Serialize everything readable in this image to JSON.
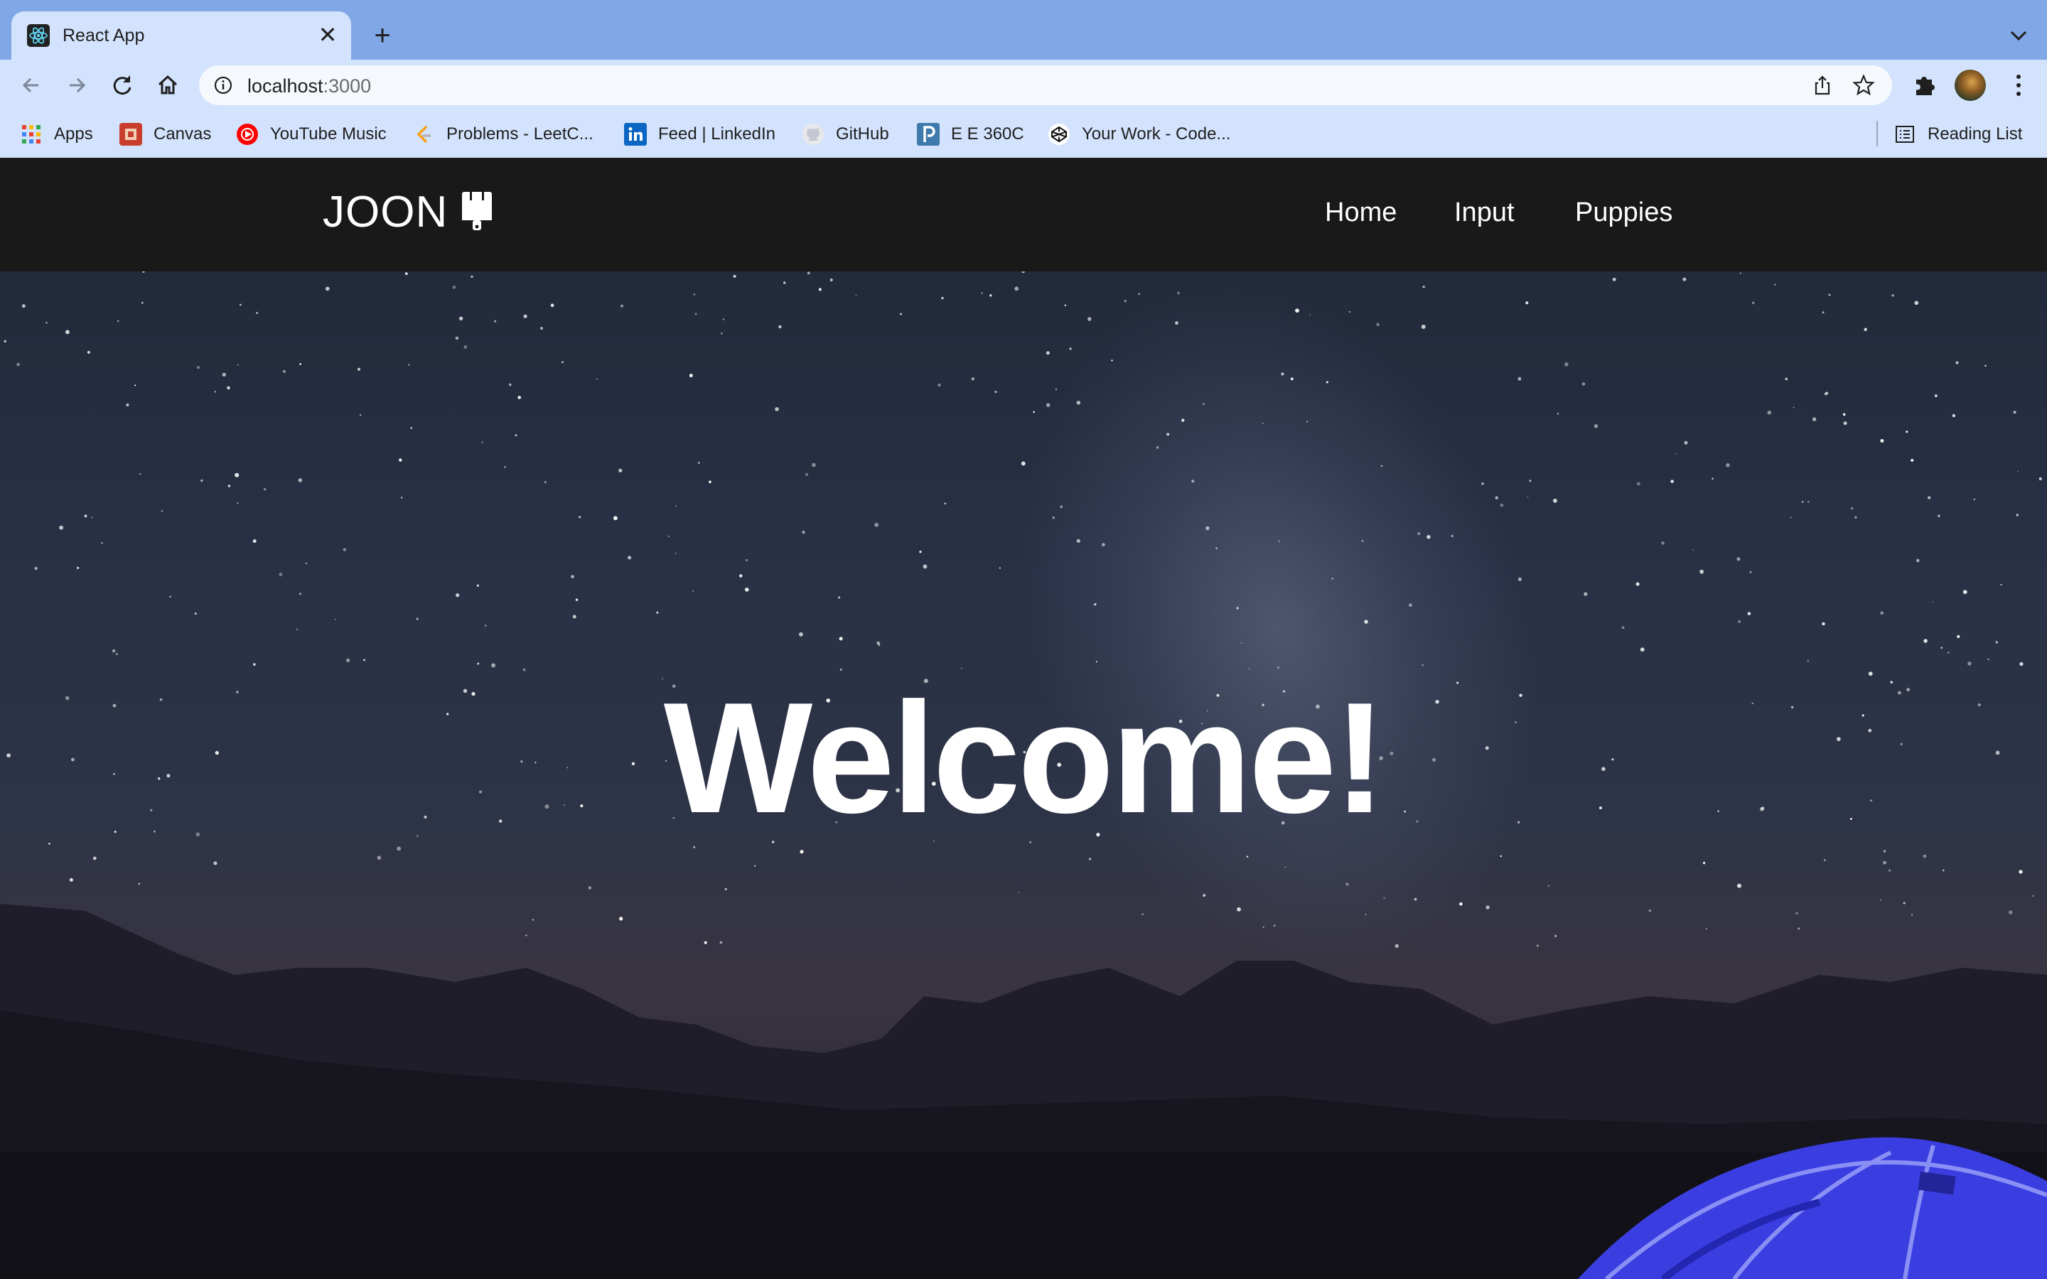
{
  "browser": {
    "tab": {
      "title": "React App",
      "favicon": "react-icon",
      "close_glyph": "✕"
    },
    "new_tab_glyph": "+",
    "url": {
      "host": "localhost",
      "port": ":3000"
    },
    "bookmarks": [
      {
        "label": "Apps",
        "icon": "apps-grid-icon"
      },
      {
        "label": "Canvas",
        "icon": "canvas-icon"
      },
      {
        "label": "YouTube Music",
        "icon": "youtube-music-icon"
      },
      {
        "label": "Problems - LeetC...",
        "icon": "leetcode-icon"
      },
      {
        "label": "Feed | LinkedIn",
        "icon": "linkedin-icon"
      },
      {
        "label": "GitHub",
        "icon": "github-icon"
      },
      {
        "label": "E E 360C",
        "icon": "piazza-icon"
      },
      {
        "label": "Your Work - Code...",
        "icon": "codepen-icon"
      }
    ],
    "reading_list": "Reading List"
  },
  "site": {
    "logo": "JOON",
    "logo_icon": "paint-brush-icon",
    "nav": [
      "Home",
      "Input",
      "Puppies"
    ],
    "hero_title": "Welcome!"
  },
  "colors": {
    "tab_strip": "#80a7e6",
    "toolbar": "#d3e3fd",
    "site_nav": "#1a1919",
    "tent": "#3a3ee0"
  }
}
